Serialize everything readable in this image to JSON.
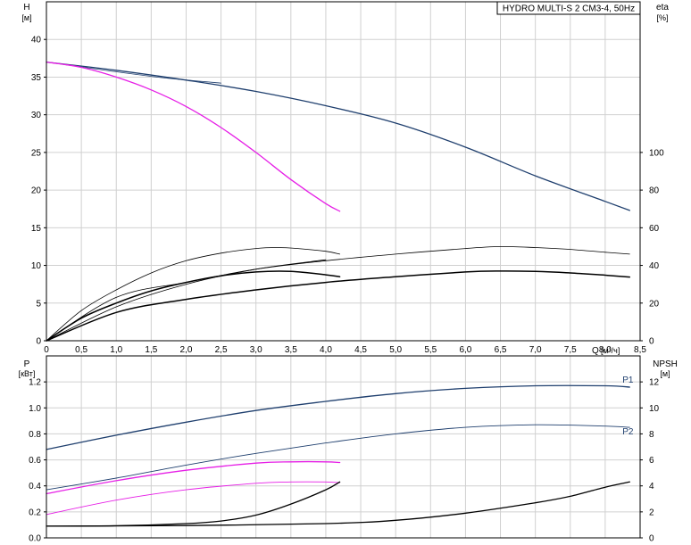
{
  "title": "HYDRO MULTI-S 2 CM3-4, 50Hz",
  "chart_data": [
    {
      "type": "line",
      "panel": "top",
      "xlabel": "Q",
      "xunit": "[м³/ч]",
      "xlim": [
        0,
        8.5
      ],
      "xticks": [
        "0",
        "0,5",
        "1,0",
        "1,5",
        "2,0",
        "2,5",
        "3,0",
        "3,5",
        "4,0",
        "4,5",
        "5,0",
        "5,5",
        "6,0",
        "6,5",
        "7,0",
        "7,5",
        "8,0",
        "8,5"
      ],
      "ylabel": "H",
      "yunit": "[м]",
      "ylim": [
        0,
        45
      ],
      "yticks": [
        "0",
        "5",
        "10",
        "15",
        "20",
        "25",
        "30",
        "35",
        "40"
      ],
      "y2label": "eta",
      "y2unit": "[%]",
      "y2lim": [
        0,
        180
      ],
      "y2ticks": [
        "0",
        "20",
        "40",
        "60",
        "80",
        "100"
      ],
      "series": [
        {
          "axis": "left",
          "color": "#1f3f6e",
          "width": 1.3,
          "points": [
            [
              0,
              37
            ],
            [
              1,
              35.9
            ],
            [
              2,
              34.6
            ],
            [
              3,
              33.1
            ],
            [
              4,
              31.2
            ],
            [
              5,
              28.9
            ],
            [
              6,
              25.7
            ],
            [
              7,
              21.9
            ],
            [
              8,
              18.5
            ],
            [
              8.35,
              17.3
            ]
          ]
        },
        {
          "axis": "left",
          "color": "#1f3f6e",
          "width": 0.8,
          "points": [
            [
              0,
              37
            ],
            [
              1.5,
              35.1
            ],
            [
              2.5,
              34.2
            ]
          ]
        },
        {
          "axis": "left",
          "color": "#e61fe6",
          "width": 1.3,
          "points": [
            [
              0,
              37
            ],
            [
              0.5,
              36.3
            ],
            [
              1,
              35.0
            ],
            [
              1.5,
              33.3
            ],
            [
              2,
              31.1
            ],
            [
              2.5,
              28.3
            ],
            [
              3,
              25.0
            ],
            [
              3.5,
              21.4
            ],
            [
              4,
              18.2
            ],
            [
              4.2,
              17.2
            ]
          ]
        },
        {
          "axis": "right",
          "color": "#000000",
          "width": 0.8,
          "points": [
            [
              0,
              0
            ],
            [
              0.5,
              16
            ],
            [
              1,
              27
            ],
            [
              1.5,
              36
            ],
            [
              2,
              42.5
            ],
            [
              2.5,
              46.5
            ],
            [
              3,
              49
            ],
            [
              3.3,
              49.5
            ],
            [
              3.6,
              49
            ],
            [
              4,
              47.5
            ],
            [
              4.2,
              46
            ]
          ]
        },
        {
          "axis": "right",
          "color": "#000000",
          "width": 0.8,
          "points": [
            [
              0,
              0
            ],
            [
              1,
              23
            ],
            [
              2,
              31
            ],
            [
              3,
              38
            ],
            [
              4,
              42.5
            ],
            [
              5,
              46
            ],
            [
              6,
              49
            ],
            [
              6.5,
              50
            ],
            [
              7,
              49.5
            ],
            [
              7.5,
              48.5
            ],
            [
              8,
              47
            ],
            [
              8.35,
              46
            ]
          ]
        },
        {
          "axis": "right",
          "color": "#000000",
          "width": 1.5,
          "points": [
            [
              0,
              0
            ],
            [
              0.5,
              12
            ],
            [
              1,
              20
            ],
            [
              1.5,
              26.5
            ],
            [
              2,
              31
            ],
            [
              2.5,
              34.5
            ],
            [
              3,
              36.5
            ],
            [
              3.5,
              36.8
            ],
            [
              4,
              35
            ],
            [
              4.2,
              34
            ]
          ]
        },
        {
          "axis": "right",
          "color": "#000000",
          "width": 1.5,
          "points": [
            [
              0,
              0
            ],
            [
              1,
              15
            ],
            [
              2,
              22
            ],
            [
              3,
              27
            ],
            [
              4,
              31
            ],
            [
              5,
              34
            ],
            [
              6,
              36.5
            ],
            [
              6.5,
              37
            ],
            [
              7,
              36.8
            ],
            [
              7.5,
              36
            ],
            [
              8,
              34.8
            ],
            [
              8.35,
              33.8
            ]
          ]
        },
        {
          "axis": "right",
          "color": "#000000",
          "width": 0.8,
          "points": [
            [
              0,
              0
            ],
            [
              1,
              18
            ],
            [
              2,
              30
            ],
            [
              3,
              38
            ],
            [
              4,
              43
            ]
          ]
        }
      ]
    },
    {
      "type": "line",
      "panel": "bottom",
      "xlim": [
        0,
        8.5
      ],
      "ylabel": "P",
      "yunit": "[кВт]",
      "ylim": [
        0,
        1.4
      ],
      "yticks": [
        "0.0",
        "0.2",
        "0.4",
        "0.6",
        "0.8",
        "1.0",
        "1.2"
      ],
      "y2label": "NPSH",
      "y2unit": "[м]",
      "y2lim": [
        0,
        14
      ],
      "y2ticks": [
        "0",
        "2",
        "4",
        "6",
        "8",
        "10",
        "12"
      ],
      "series": [
        {
          "name": "P1",
          "axis": "left",
          "color": "#1f3f6e",
          "width": 1.3,
          "points": [
            [
              0,
              0.68
            ],
            [
              1,
              0.79
            ],
            [
              2,
              0.89
            ],
            [
              3,
              0.98
            ],
            [
              4,
              1.05
            ],
            [
              5,
              1.11
            ],
            [
              6,
              1.15
            ],
            [
              7,
              1.17
            ],
            [
              8,
              1.17
            ],
            [
              8.35,
              1.16
            ]
          ]
        },
        {
          "name": "P2",
          "axis": "left",
          "color": "#1f3f6e",
          "width": 0.9,
          "points": [
            [
              0,
              0.37
            ],
            [
              1,
              0.46
            ],
            [
              2,
              0.56
            ],
            [
              3,
              0.65
            ],
            [
              4,
              0.73
            ],
            [
              5,
              0.8
            ],
            [
              6,
              0.85
            ],
            [
              7,
              0.87
            ],
            [
              8,
              0.86
            ],
            [
              8.35,
              0.85
            ]
          ]
        },
        {
          "axis": "left",
          "color": "#e61fe6",
          "width": 1.3,
          "points": [
            [
              0,
              0.34
            ],
            [
              1,
              0.44
            ],
            [
              2,
              0.52
            ],
            [
              3,
              0.575
            ],
            [
              3.5,
              0.585
            ],
            [
              4,
              0.585
            ],
            [
              4.2,
              0.58
            ]
          ]
        },
        {
          "axis": "left",
          "color": "#e61fe6",
          "width": 0.9,
          "points": [
            [
              0,
              0.18
            ],
            [
              1,
              0.29
            ],
            [
              2,
              0.37
            ],
            [
              3,
              0.42
            ],
            [
              3.5,
              0.43
            ],
            [
              4,
              0.43
            ],
            [
              4.2,
              0.425
            ]
          ]
        },
        {
          "axis": "right",
          "color": "#000000",
          "width": 1.3,
          "points": [
            [
              0,
              0.9
            ],
            [
              1,
              0.93
            ],
            [
              2,
              1.1
            ],
            [
              2.5,
              1.3
            ],
            [
              3,
              1.75
            ],
            [
              3.5,
              2.6
            ],
            [
              4,
              3.7
            ],
            [
              4.2,
              4.3
            ]
          ]
        },
        {
          "axis": "right",
          "color": "#000000",
          "width": 1.3,
          "points": [
            [
              0,
              0.9
            ],
            [
              2,
              0.95
            ],
            [
              4,
              1.1
            ],
            [
              5,
              1.35
            ],
            [
              6,
              1.9
            ],
            [
              7,
              2.7
            ],
            [
              7.5,
              3.2
            ],
            [
              8,
              3.9
            ],
            [
              8.35,
              4.3
            ]
          ]
        }
      ]
    }
  ]
}
